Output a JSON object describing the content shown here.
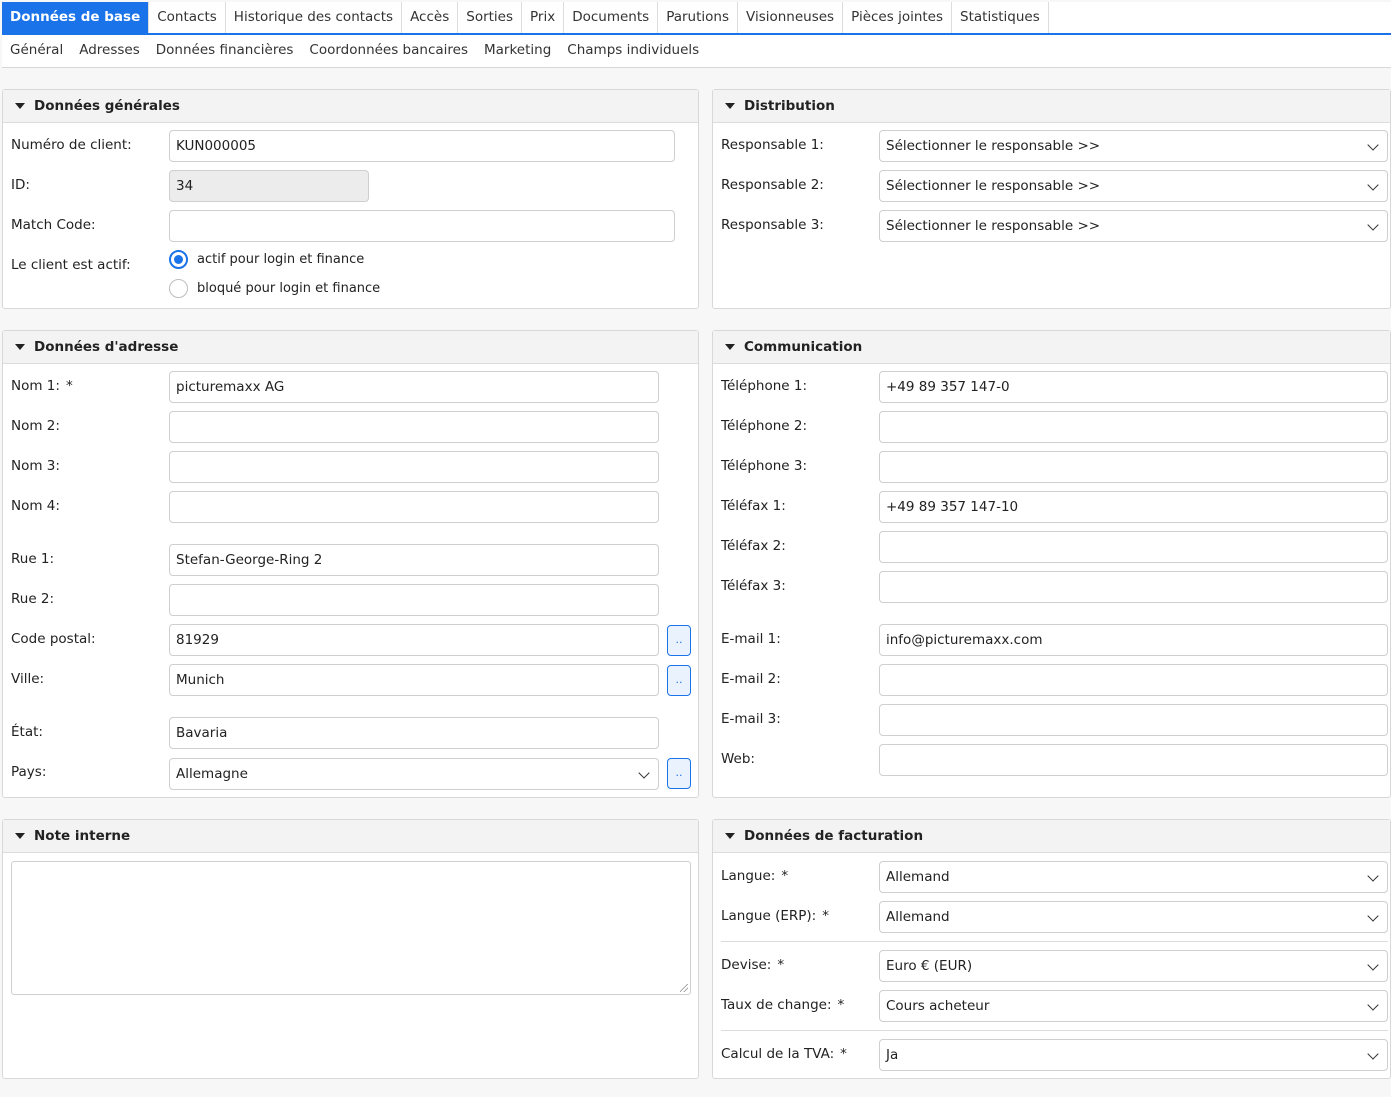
{
  "tabs": [
    "Données de base",
    "Contacts",
    "Historique des contacts",
    "Accès",
    "Sorties",
    "Prix",
    "Documents",
    "Parutions",
    "Visionneuses",
    "Pièces jointes",
    "Statistiques"
  ],
  "subtabs": [
    "Général",
    "Adresses",
    "Données financières",
    "Coordonnées bancaires",
    "Marketing",
    "Champs individuels"
  ],
  "general": {
    "title": "Données générales",
    "customer_no_label": "Numéro de client:",
    "customer_no": "KUN000005",
    "id_label": "ID:",
    "id": "34",
    "match_code_label": "Match Code:",
    "match_code": "",
    "active_label": "Le client est actif:",
    "radio_active": "actif pour login et finance",
    "radio_blocked": "bloqué pour login et finance"
  },
  "distribution": {
    "title": "Distribution",
    "resp1_label": "Responsable 1:",
    "resp2_label": "Responsable 2:",
    "resp3_label": "Responsable 3:",
    "resp1": "Sélectionner le responsable >>",
    "resp2": "Sélectionner le responsable >>",
    "resp3": "Sélectionner le responsable >>"
  },
  "address": {
    "title": "Données d'adresse",
    "nom1_label": "Nom 1:",
    "nom1": "picturemaxx AG",
    "nom2_label": "Nom 2:",
    "nom2": "",
    "nom3_label": "Nom 3:",
    "nom3": "",
    "nom4_label": "Nom 4:",
    "nom4": "",
    "rue1_label": "Rue 1:",
    "rue1": "Stefan-George-Ring 2",
    "rue2_label": "Rue 2:",
    "rue2": "",
    "zip_label": "Code postal:",
    "zip": "81929",
    "city_label": "Ville:",
    "city": "Munich",
    "state_label": "État:",
    "state": "Bavaria",
    "country_label": "Pays:",
    "country": "Allemagne",
    "lookup": ".."
  },
  "communication": {
    "title": "Communication",
    "tel1_label": "Téléphone 1:",
    "tel1": "+49 89 357 147-0",
    "tel2_label": "Téléphone 2:",
    "tel2": "",
    "tel3_label": "Téléphone 3:",
    "tel3": "",
    "fax1_label": "Téléfax 1:",
    "fax1": "+49 89 357 147-10",
    "fax2_label": "Téléfax 2:",
    "fax2": "",
    "fax3_label": "Téléfax 3:",
    "fax3": "",
    "mail1_label": "E-mail 1:",
    "mail1": "info@picturemaxx.com",
    "mail2_label": "E-mail 2:",
    "mail2": "",
    "mail3_label": "E-mail 3:",
    "mail3": "",
    "web_label": "Web:",
    "web": ""
  },
  "note": {
    "title": "Note interne",
    "text": ""
  },
  "billing": {
    "title": "Données de facturation",
    "lang_label": "Langue:",
    "lang": "Allemand",
    "lang_erp_label": "Langue (ERP):",
    "lang_erp": "Allemand",
    "currency_label": "Devise:",
    "currency": "Euro € (EUR)",
    "rate_label": "Taux de change:",
    "rate": "Cours acheteur",
    "vat_label": "Calcul de la TVA:",
    "vat": "Ja"
  },
  "required_mark": "*"
}
